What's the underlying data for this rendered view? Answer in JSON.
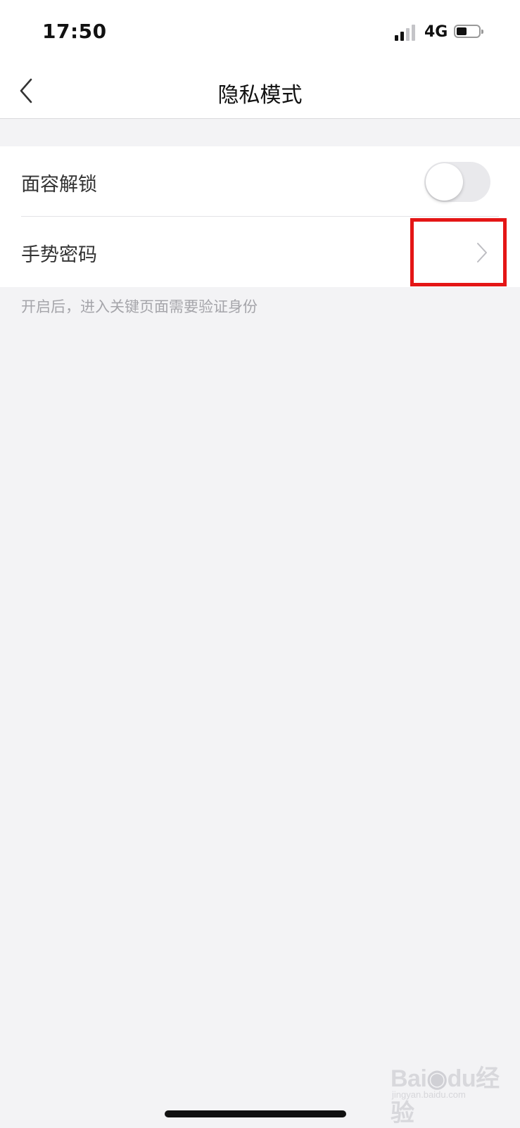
{
  "status_bar": {
    "time": "17:50",
    "network": "4G",
    "signal_bars_active": 2,
    "signal_bars_total": 4,
    "battery_level": 0.45
  },
  "nav": {
    "back_icon": "chevron-left-icon",
    "title": "隐私模式"
  },
  "settings": {
    "items": [
      {
        "label": "面容解锁",
        "control": "toggle",
        "toggle_on": false
      },
      {
        "label": "手势密码",
        "control": "chevron",
        "icon": "chevron-right-icon"
      }
    ],
    "hint": "开启后，进入关键页面需要验证身份"
  },
  "watermark": {
    "brand_text_1": "Bai",
    "brand_text_2": "du",
    "brand_text_3": "经验",
    "domain": "jingyan.baidu.com"
  },
  "colors": {
    "highlight": "#e41616",
    "background": "#f3f3f5"
  }
}
